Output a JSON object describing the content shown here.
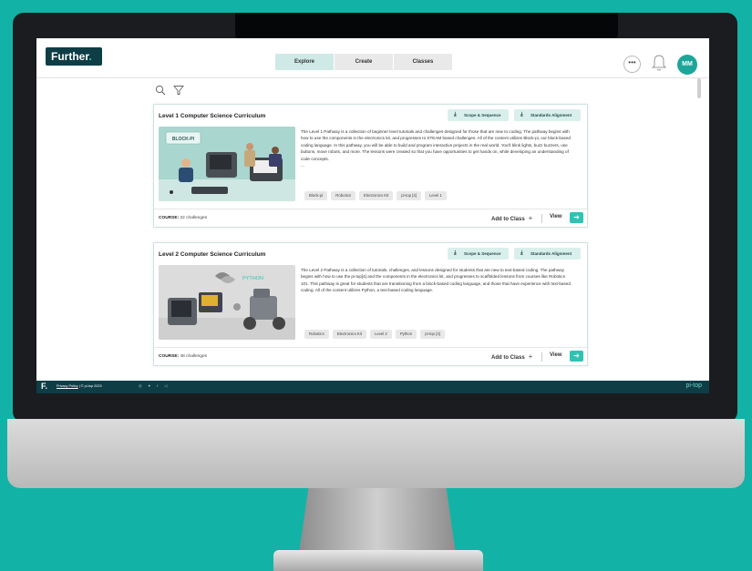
{
  "brand": {
    "logo_text": "Further",
    "logo_mark": "."
  },
  "nav": {
    "tabs": [
      {
        "label": "Explore",
        "active": true
      },
      {
        "label": "Create",
        "active": false
      },
      {
        "label": "Classes",
        "active": false
      }
    ]
  },
  "header": {
    "more_label": "•••",
    "avatar_initials": "MM"
  },
  "icons": {
    "search": "search-icon",
    "filter": "filter-icon",
    "bell": "bell-icon",
    "download": "download-icon",
    "arrow": "arrow-right-icon"
  },
  "colors": {
    "accent": "#2fc3b3",
    "brand_dark": "#0e3d46",
    "background": "#12b3a6",
    "pill": "#d9efec"
  },
  "courses": [
    {
      "title": "Level 1 Computer Science Curriculum",
      "scope_label": "Scope & Sequence",
      "standards_label": "Standards Alignment",
      "image_label": "BLOCK-PI",
      "description": "The Level 1 Pathway is a collection of beginner level tutorials and challenges designed for those that are new to coding. The pathway begins with how to use the components in the electronics kit, and progresses to STEAM based challenges. All of the content utilizes Block-pi, our block-based coding language. In this pathway, you will be able to build and program interactive projects in the real world. You'll blink lights, buzz buzzers, use buttons, move robots, and more. The lessons were created so that you have opportunities to get hands on, while developing an understanding of code concepts.",
      "ellipsis": "...",
      "tags": [
        "Block-pi",
        "Robotics",
        "Electronics Kit",
        "pi-top [4]",
        "Level 1"
      ],
      "course_label": "COURSE:",
      "challenges": "22 challenges",
      "add_label": "Add to Class",
      "view_label": "View"
    },
    {
      "title": "Level 2 Computer Science Curriculum",
      "scope_label": "Scope & Sequence",
      "standards_label": "Standards Alignment",
      "image_label": "PYTHON",
      "description": "The Level 2 Pathway is a collection of tutorials, challenges, and lessons designed for students that are new to text-based coding. The pathway begins with how to use the pi-top[4] and the components in the electronics kit, and progresses to scaffolded lessons from courses like Robotics 101. This pathway is great for students that are transitioning from a block-based coding language, and those that have experience with text-based coding. All of the content utilizes Python, a text-based coding language.",
      "ellipsis": "",
      "tags": [
        "Robotics",
        "Electronics Kit",
        "Level 2",
        "Python",
        "pi-top [4]"
      ],
      "course_label": "COURSE:",
      "challenges": "48 challenges",
      "add_label": "Add to Class",
      "view_label": "View"
    }
  ],
  "footer": {
    "logo": "F.",
    "privacy_label": "Privacy Policy",
    "separator": "|",
    "copyright": "© pi-top 2023",
    "brand": "pi-top"
  }
}
